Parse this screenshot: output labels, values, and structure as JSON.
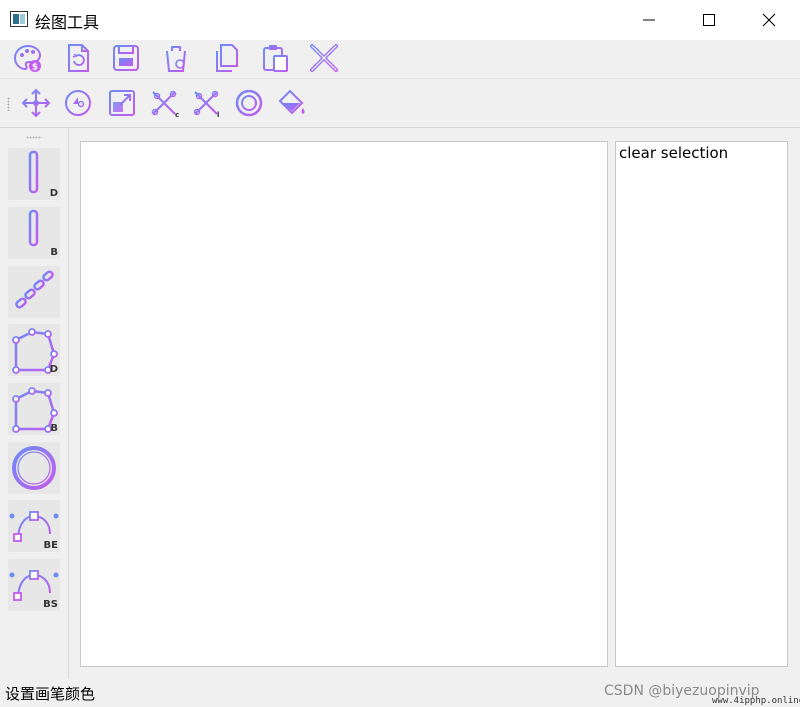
{
  "window": {
    "title": "绘图工具"
  },
  "toolbar_main": [
    {
      "name": "palette-icon"
    },
    {
      "name": "new-file-icon"
    },
    {
      "name": "save-icon"
    },
    {
      "name": "clear-bin-icon"
    },
    {
      "name": "copy-icon"
    },
    {
      "name": "paste-icon"
    },
    {
      "name": "delete-x-icon"
    }
  ],
  "toolbar_transform": [
    {
      "name": "move-icon"
    },
    {
      "name": "rotate-icon"
    },
    {
      "name": "scale-icon"
    },
    {
      "name": "clip-c-icon"
    },
    {
      "name": "clip-l-icon"
    },
    {
      "name": "ellipse-target-icon"
    },
    {
      "name": "fill-bucket-icon"
    }
  ],
  "side_tools": [
    {
      "name": "line-dda-tool",
      "sub": "D"
    },
    {
      "name": "line-bresenham-tool",
      "sub": "B"
    },
    {
      "name": "polyline-tool",
      "sub": ""
    },
    {
      "name": "polygon-dda-tool",
      "sub": "D"
    },
    {
      "name": "polygon-bresenham-tool",
      "sub": "B"
    },
    {
      "name": "ellipse-tool",
      "sub": ""
    },
    {
      "name": "curve-bezier-tool",
      "sub": "BE"
    },
    {
      "name": "curve-bspline-tool",
      "sub": "BS"
    }
  ],
  "selection_list": {
    "items": [
      "clear selection"
    ]
  },
  "status": {
    "message": "设置画笔颜色"
  },
  "watermark": {
    "text": "CSDN @biyezuopinvip",
    "sub": "www.4ipphp.online"
  },
  "colors": {
    "gradient_start": "#6d8cf5",
    "gradient_end": "#c45af0"
  }
}
